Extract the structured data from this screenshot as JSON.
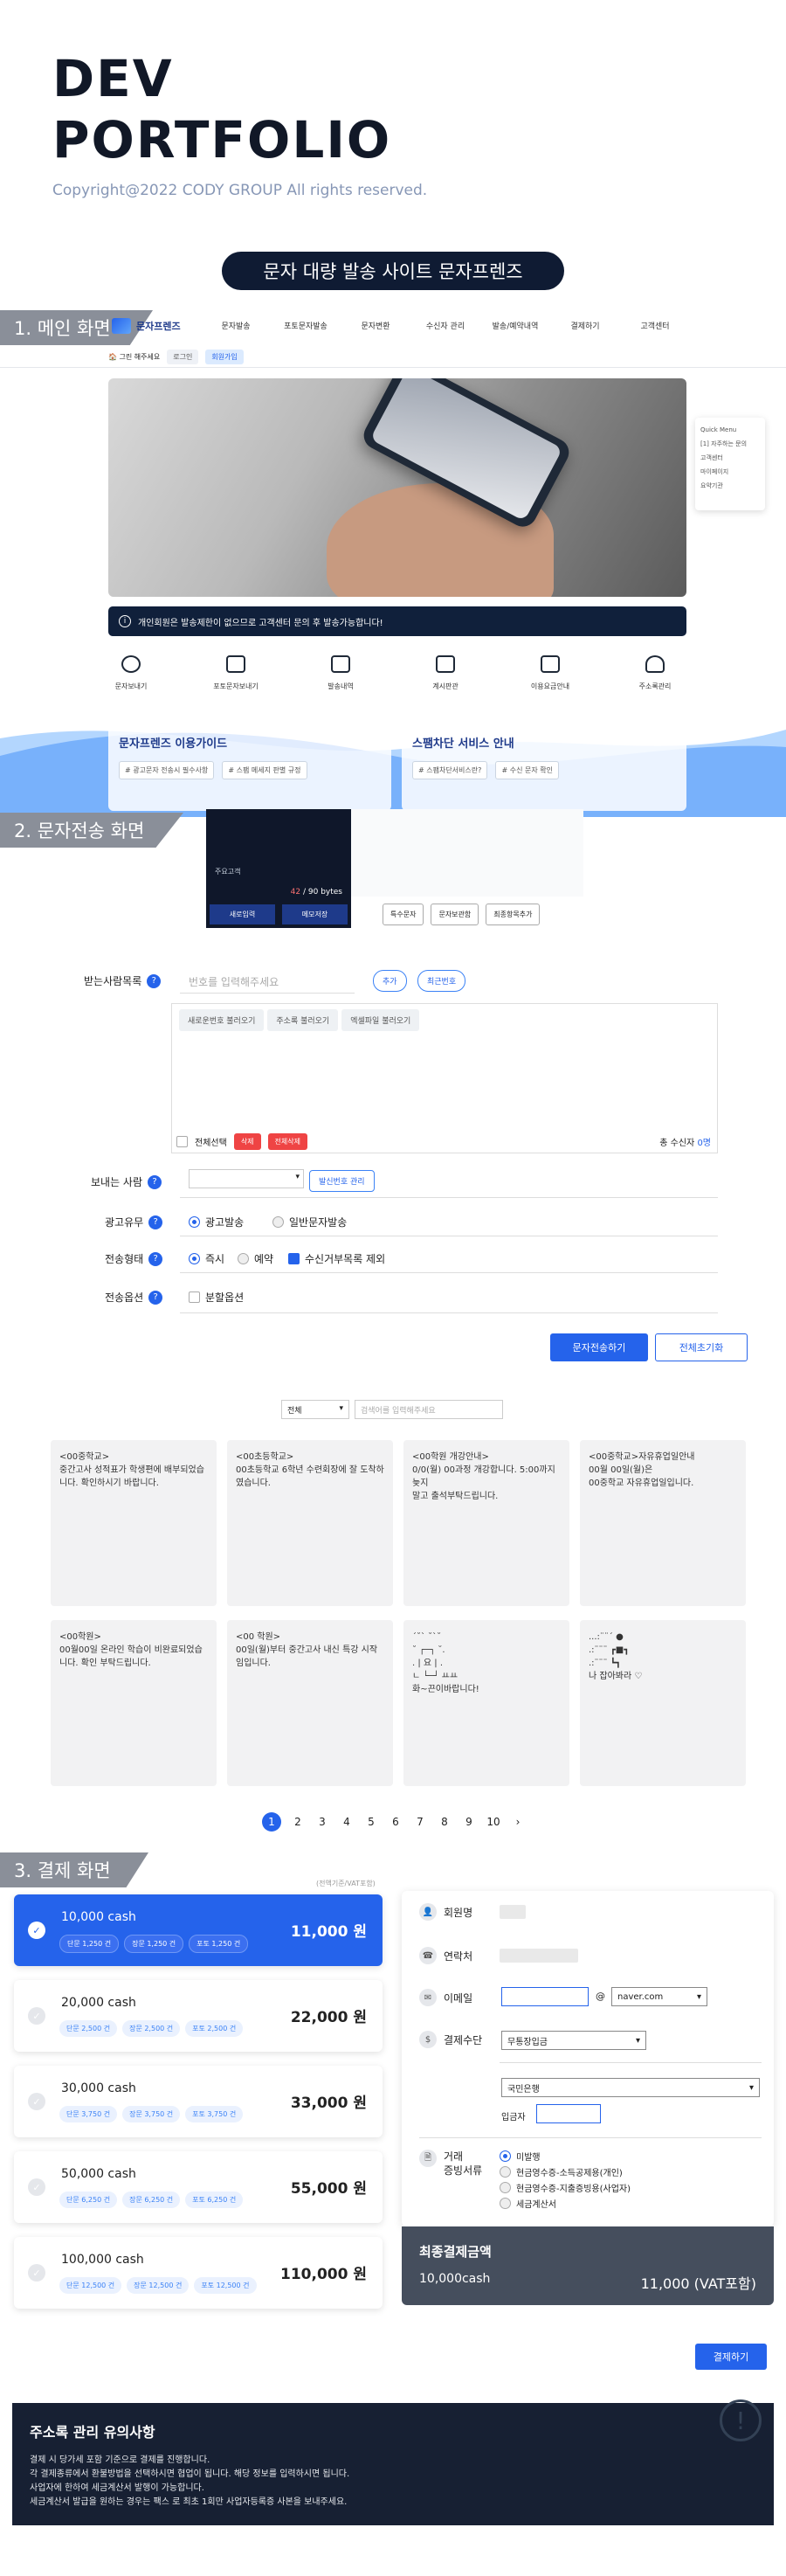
{
  "header": {
    "title_line1": "DEV",
    "title_line2": "PORTFOLIO",
    "copyright": "Copyright@2022 CODY GROUP All rights reserved.",
    "project_title": "문자 대량 발송 사이트 문자프렌즈"
  },
  "sections": {
    "s1": "1. 메인 화면",
    "s2": "2. 문자전송 화면",
    "s3": "3. 결제 화면"
  },
  "main_screen": {
    "logo": "문자프렌즈",
    "nav": [
      "문자발송",
      "포토문자발송",
      "문자변환",
      "수신자 관리",
      "발송/예약내역",
      "결제하기",
      "고객센터"
    ],
    "subnav_label": "🏠 그린 해주세요",
    "subnav_chips": [
      "로그인",
      "회원가입"
    ],
    "quick_menu": [
      "Quick Menu",
      "[1] 자주하는 문의",
      "고객센터",
      "마이페이지",
      "요약기관"
    ],
    "notice": "개인회원은 발송제한이 없으므로 고객센터 문의 후 발송가능합니다!",
    "icons": [
      "문자보내기",
      "포토문자보내기",
      "발송내역",
      "계시판관",
      "이용요금안내",
      "주소록관리"
    ],
    "guide_left_title": "문자프렌즈 이용가이드",
    "guide_left_tags": [
      "# 광고문자 전송시 필수사항",
      "# 스팸 메세지 판별 규정",
      ""
    ],
    "guide_right_title": "스팸차단 서비스 안내",
    "guide_right_tags": [
      "# 스팸차단서비스란?",
      "# 수신 문자 확인"
    ]
  },
  "sms": {
    "preview_label": "주요고객",
    "byte_used": "42",
    "byte_max": "/ 90 bytes",
    "btn_new": "새로입력",
    "btn_save": "메모저장",
    "special_btns": [
      "특수문자",
      "문자보관함",
      "최종항목추가"
    ],
    "recipients_label": "받는사람목록",
    "phone_placeholder": "번호를 입력해주세요",
    "btn_add": "추가",
    "btn_recent": "최근번호",
    "recv_tabs": [
      "새로운번호 불러오기",
      "주소록 불러오기",
      "엑셀파일 불러오기"
    ],
    "select_all": "전체선택",
    "btn_delete": "삭제",
    "btn_delete_all": "전체삭제",
    "recv_total": "총 수신자",
    "recv_count": "0명",
    "sender_label": "보내는 사람",
    "sender_btn": "발신번호 관리",
    "ad_label": "광고유무",
    "ad_options": [
      "광고발송",
      "일반문자발송"
    ],
    "send_label": "전송형태",
    "send_options": [
      "즉시",
      "예약",
      "수신거부목록 제외"
    ],
    "opt_label": "전송옵션",
    "opt_value": "분할옵션",
    "btn_send": "문자전송하기",
    "btn_reset": "전체초기화"
  },
  "templates": {
    "select": "전체",
    "search_placeholder": "검색어를 입력해주세요",
    "cards": [
      "<00중학교>\n중간고사 성적표가 학생편에 배부되었습니다. 확인하시기 바랍니다.",
      "<00초등학교>\n00초등학교 6학년 수련회장에 잘 도착하였습니다.",
      "<00학원 개강안내>\n0/0(월) 00과정 개강합니다. 5:00까지 늦지\n말고 출석부탁드립니다.",
      "<00중학교>자유휴업일안내\n00월 00일(월)은\n00중학교 자유휴업일입니다.",
      "<00학원>\n00월00일 온라인 학습이 비완료되었습니다. 확인 부탁드립니다.",
      "<00 학원>\n00일(월)부터 중간고사 내신 특강 시작임입니다.",
      "´˘` ˘`˘\n ˘ ┌─┐ ˘.\n . | 요 | .\n ㄴ └─┘ ㅛㅛ\n화~끈이바랍니다!",
      "...:¨¨´ ●\n.:¨¨¨ ┏■┓\n.:¨¨¨ ┗┓\n나 잡아봐라 ♡"
    ],
    "pages": [
      "1",
      "2",
      "3",
      "4",
      "5",
      "6",
      "7",
      "8",
      "9",
      "10",
      "›"
    ]
  },
  "payment": {
    "vat_note": "(전액기준/VAT포함)",
    "plans": [
      {
        "name": "10,000 cash",
        "price": "11,000 원",
        "chips": [
          "단문 1,250 건",
          "장문 1,250 건",
          "포토 1,250 건"
        ]
      },
      {
        "name": "20,000 cash",
        "price": "22,000 원",
        "chips": [
          "단문 2,500 건",
          "장문 2,500 건",
          "포토 2,500 건"
        ]
      },
      {
        "name": "30,000 cash",
        "price": "33,000 원",
        "chips": [
          "단문 3,750 건",
          "장문 3,750 건",
          "포토 3,750 건"
        ]
      },
      {
        "name": "50,000 cash",
        "price": "55,000 원",
        "chips": [
          "단문 6,250 건",
          "장문 6,250 건",
          "포토 6,250 건"
        ]
      },
      {
        "name": "100,000 cash",
        "price": "110,000 원",
        "chips": [
          "단문 12,500 건",
          "장문 12,500 건",
          "포토 12,500 건"
        ]
      }
    ],
    "member_label": "회원명",
    "contact_label": "연락처",
    "email_label": "이메일",
    "email_at": "@",
    "email_domain": "naver.com",
    "pay_label": "결제수단",
    "pay_method": "무통장입금",
    "bank": "국민은행",
    "depositor_label": "입금자",
    "receipt_label_1": "거래",
    "receipt_label_2": "증빙서류",
    "receipt_options": [
      "미발행",
      "현금영수증-소득공제용(개인)",
      "현금영수증-지출증빙용(사업자)",
      "세금계산서"
    ],
    "total_label": "최종결제금액",
    "total_cash": "10,000cash",
    "total_price": "11,000 (VAT포함)",
    "btn_pay": "결제하기"
  },
  "notice_box": {
    "title": "주소록 관리 유의사항",
    "lines": [
      "결제 시 당가세 포함 기준으로 결제를 진행합니다.",
      "각 결제종류에서 환불방법을 선택하시면 협업이 됩니다. 해당 정보를 입력하시면 됩니다.",
      "사업자에 한하여 세금계산서 발행이 가능합니다.",
      "세금계산서 발급을 원하는 경우는 팩스                로 최초 1회만 사업자등록증 사본을 보내주세요."
    ]
  }
}
